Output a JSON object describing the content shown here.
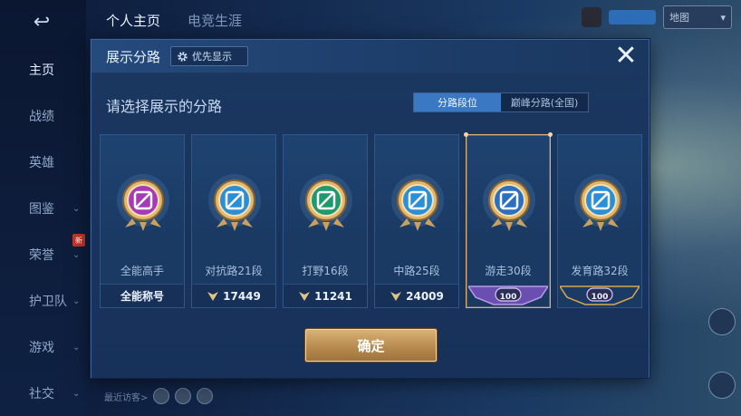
{
  "background": {
    "back_arrow": "↩",
    "sidebar_items": [
      {
        "label": "主页",
        "active": true,
        "chev": ""
      },
      {
        "label": "战绩",
        "active": false,
        "chev": ""
      },
      {
        "label": "英雄",
        "active": false,
        "chev": ""
      },
      {
        "label": "图鉴",
        "active": false,
        "chev": "⌄"
      },
      {
        "label": "荣誉",
        "active": false,
        "chev": "⌄"
      },
      {
        "label": "护卫队",
        "active": false,
        "chev": "⌄"
      },
      {
        "label": "游戏",
        "active": false,
        "chev": "⌄"
      },
      {
        "label": "社交",
        "active": false,
        "chev": "⌄"
      }
    ],
    "top_tabs": [
      "个人主页",
      "电竞生涯"
    ],
    "dropdown_label": "地图",
    "recent_visitors_label": "最近访客>",
    "new_tag": "新"
  },
  "modal": {
    "title": "展示分路",
    "priority_label": "优先显示",
    "close_symbol": "✕",
    "subtitle": "请选择展示的分路",
    "segments": [
      {
        "label": "分路段位",
        "active": true
      },
      {
        "label": "巅峰分路(全国)",
        "active": false
      }
    ],
    "cards": [
      {
        "label": "全能高手",
        "foot": "全能称号",
        "foot_type": "text",
        "badge": "allround-badge-icon",
        "badge_color": "#a63bb8",
        "selected": false
      },
      {
        "label": "对抗路21段",
        "foot": "17449",
        "foot_type": "points",
        "badge": "clash-lane-badge-icon",
        "badge_color": "#2a8fd6",
        "selected": false
      },
      {
        "label": "打野16段",
        "foot": "11241",
        "foot_type": "points",
        "badge": "jungle-badge-icon",
        "badge_color": "#1e9a6e",
        "selected": false
      },
      {
        "label": "中路25段",
        "foot": "24009",
        "foot_type": "points",
        "badge": "mid-lane-badge-icon",
        "badge_color": "#2a8fd6",
        "selected": false
      },
      {
        "label": "游走30段",
        "foot": "100",
        "foot_type": "ribbon-purple",
        "badge": "roam-badge-icon",
        "badge_color": "#2a6fc0",
        "selected": true
      },
      {
        "label": "发育路32段",
        "foot": "100",
        "foot_type": "ribbon-gold",
        "badge": "farm-lane-badge-icon",
        "badge_color": "#2a8fd6",
        "selected": false
      }
    ],
    "confirm_label": "确定"
  },
  "colors": {
    "accent_gold": "#d8b276",
    "segment_active": "#3a78c4",
    "modal_bg": "#1c3963"
  }
}
